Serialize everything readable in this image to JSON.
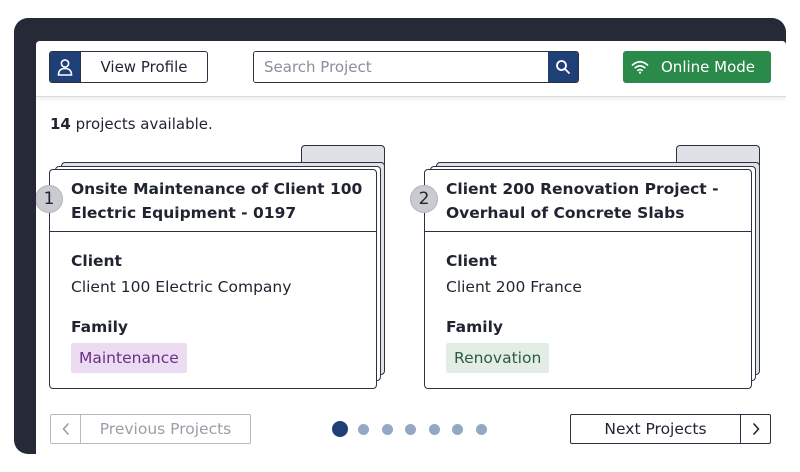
{
  "header": {
    "profile_label": "View Profile",
    "search_placeholder": "Search Project",
    "search_value": "",
    "online_label": "Online Mode"
  },
  "summary": {
    "count": "14",
    "text": "projects available."
  },
  "projects": [
    {
      "number": "1",
      "title": "Onsite Maintenance of Client 100 Electric Equipment - 0197",
      "client_label": "Client",
      "client": "Client 100 Electric Company",
      "family_label": "Family",
      "family": "Maintenance",
      "family_color": "#ecdcf1",
      "family_text_color": "#6b2f8a"
    },
    {
      "number": "2",
      "title": "Client 200 Renovation Project - Overhaul of Concrete Slabs",
      "client_label": "Client",
      "client": "Client 200 France",
      "family_label": "Family",
      "family": "Renovation",
      "family_color": "#e2ede5",
      "family_text_color": "#2f5a3c"
    }
  ],
  "pagination": {
    "previous_label": "Previous Projects",
    "next_label": "Next Projects",
    "pages": 7,
    "active_page": 1
  },
  "icons": {
    "profile": "user-icon",
    "search": "search-icon",
    "online": "wifi-icon",
    "previous": "chevron-left-icon",
    "next": "chevron-right-icon"
  },
  "colors": {
    "primary": "#1f3f77",
    "online": "#2a8a4a",
    "frame": "#252a36"
  }
}
